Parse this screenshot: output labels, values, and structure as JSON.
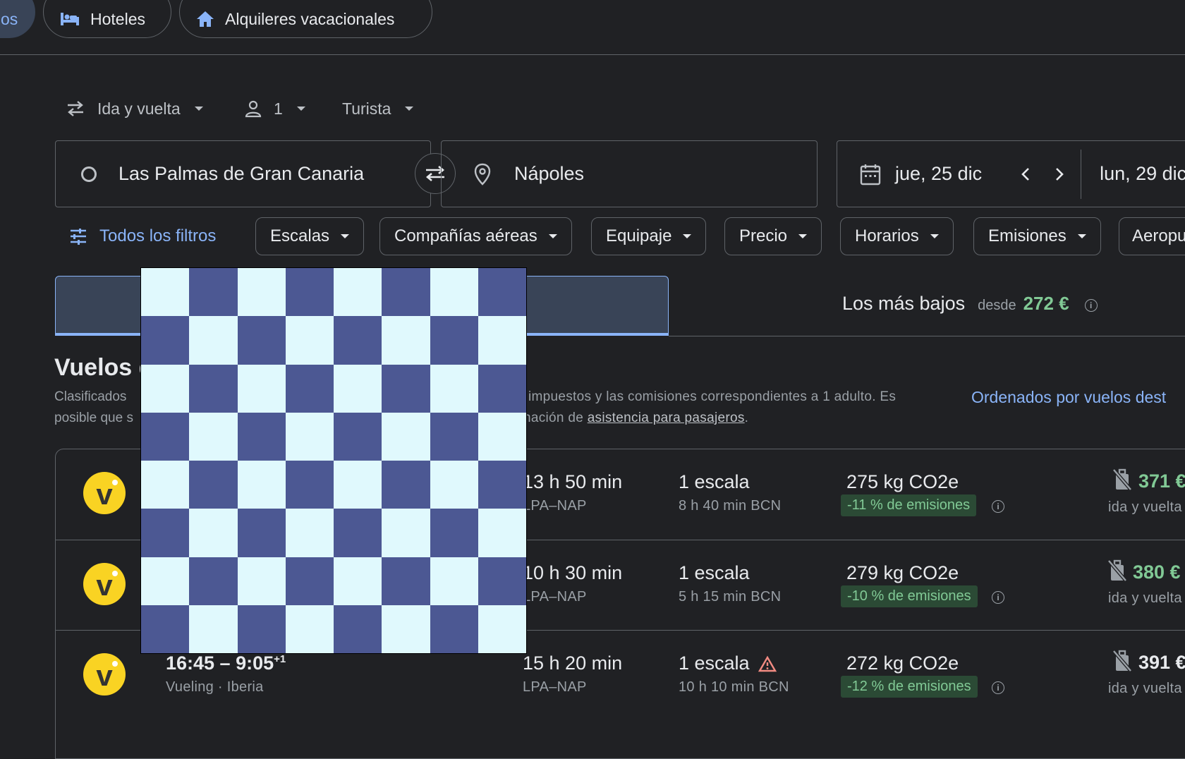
{
  "top_tabs": {
    "partial_label": "os",
    "hotels": "Hoteles",
    "rentals": "Alquileres vacacionales"
  },
  "options": {
    "trip_type": "Ida y vuelta",
    "passengers": "1",
    "cabin": "Turista"
  },
  "search": {
    "origin": "Las Palmas de Gran Canaria",
    "destination": "Nápoles",
    "depart_date": "jue, 25 dic",
    "return_date": "lun, 29 dic"
  },
  "filters": {
    "all_filters": "Todos los filtros",
    "chips": [
      "Escalas",
      "Compañías aéreas",
      "Equipaje",
      "Precio",
      "Horarios",
      "Emisiones",
      "Aeropu"
    ]
  },
  "sort_tabs": {
    "cheapest_label": "Los más bajos",
    "cheapest_from": "desde",
    "cheapest_price": "272 €"
  },
  "results": {
    "title": "Vuelos d",
    "desc_line1_left": "Clasificados",
    "desc_line1_right": "impuestos y las comisiones correspondientes a 1 adulto. Es",
    "desc_line2_left": "posible que s",
    "desc_line2_right_pre": "nación de ",
    "desc_line2_link": "asistencia para pasajeros",
    "desc_line2_post": ".",
    "sort_link": "Ordenados por vuelos dest"
  },
  "flights": [
    {
      "times": "",
      "airlines": "",
      "duration": "13 h 50 min",
      "route": "LPA–NAP",
      "stops": "1 escala",
      "layover": "8 h 40 min BCN",
      "co2": "275 kg CO2e",
      "emissions": "-11 % de emisiones",
      "price": "371 €",
      "price_type": "ida y vuelta",
      "warning": false
    },
    {
      "times": "",
      "airlines": "",
      "duration": "10 h 30 min",
      "route": "LPA–NAP",
      "stops": "1 escala",
      "layover": "5 h 15 min BCN",
      "co2": "279 kg CO2e",
      "emissions": "-10 % de emisiones",
      "price": "380 €",
      "price_type": "ida y vuelta",
      "warning": false
    },
    {
      "times": "16:45 – 9:05",
      "times_sup": "+1",
      "airlines": "Vueling · Iberia",
      "duration": "15 h 20 min",
      "route": "LPA–NAP",
      "stops": "1 escala",
      "layover": "10 h 10 min BCN",
      "co2": "272 kg CO2e",
      "emissions": "-12 % de emisiones",
      "price": "391 €",
      "price_type": "ida y vuelta",
      "warning": true
    }
  ],
  "colors": {
    "background": "#202124",
    "accent_blue": "#8ab4f8",
    "price_green": "#81c995",
    "vueling_yellow": "#f9d323"
  }
}
